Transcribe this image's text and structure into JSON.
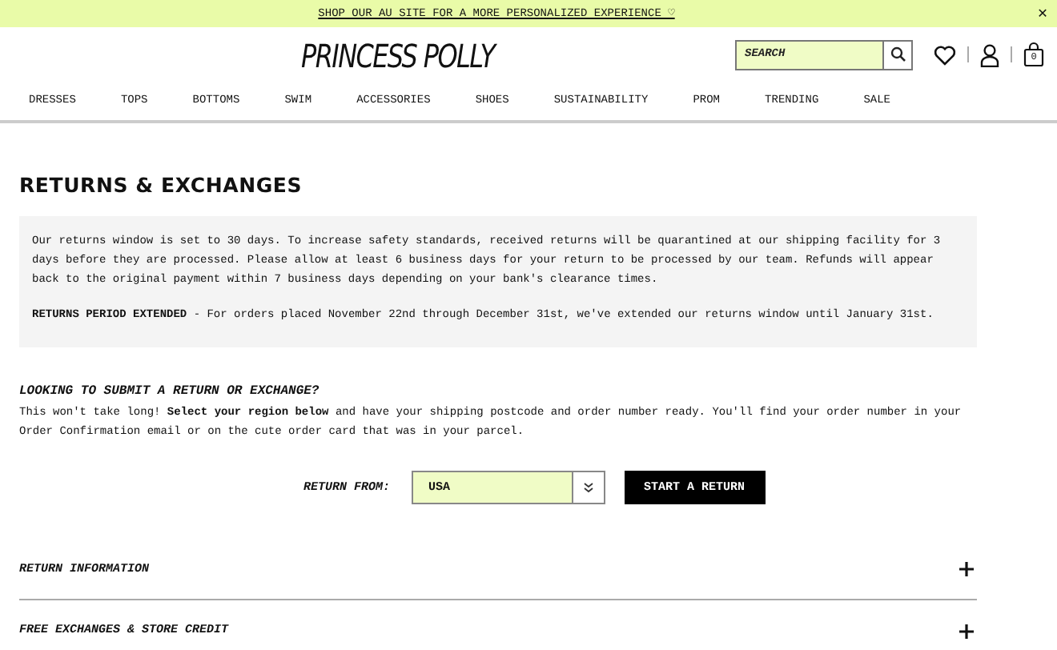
{
  "banner": {
    "text": "SHOP OUR AU SITE FOR A MORE PERSONALIZED EXPERIENCE ♡",
    "close": "✕"
  },
  "header": {
    "logo": "PRINCESS POLLY",
    "search": {
      "placeholder": "SEARCH"
    },
    "cart_count": "0"
  },
  "nav": [
    "DRESSES",
    "TOPS",
    "BOTTOMS",
    "SWIM",
    "ACCESSORIES",
    "SHOES",
    "SUSTAINABILITY",
    "PROM",
    "TRENDING",
    "SALE"
  ],
  "page_title": "RETURNS & EXCHANGES",
  "notice": {
    "paragraphs": [
      "Our returns window is set to 30 days. To increase safety standards, received returns will be quarantined at our shipping facility for 3 days before they are processed. Please allow at least 6 business days for your return to be processed by our team. Refunds will appear back to the original payment within 7 business days depending on your bank's clearance times.",
      "**RETURNS PERIOD EXTENDED** - For orders placed November 22nd through December 31st, we've extended our returns window until January 31st."
    ]
  },
  "submit": {
    "heading": "LOOKING TO SUBMIT A RETURN OR EXCHANGE?",
    "text": "This won't take long! **Select your region below** and have your shipping postcode and order number ready. You'll find your order number in your Order Confirmation email or on the cute order card that was in your parcel.",
    "region_label": "RETURN FROM:",
    "region_value": "USA",
    "button": "START A RETURN"
  },
  "accordion": [
    {
      "title": "RETURN INFORMATION",
      "expanded": false
    },
    {
      "title": "FREE EXCHANGES & STORE CREDIT",
      "expanded": false
    }
  ]
}
